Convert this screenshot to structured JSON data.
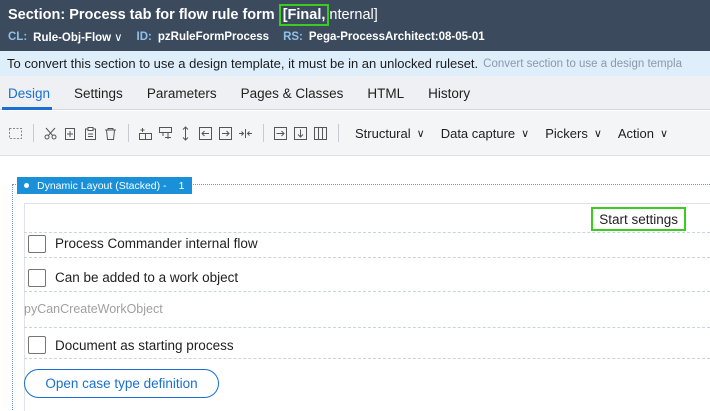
{
  "header": {
    "title": "Section: Process tab for flow rule form",
    "title_flag": "[Final,",
    "title_flag_rest": "nternal]",
    "meta": [
      {
        "label": "CL:",
        "value": "Rule-Obj-Flow",
        "chevron": "∨"
      },
      {
        "label": "ID:",
        "value": "pzRuleFormProcess",
        "chevron": ""
      },
      {
        "label": "RS:",
        "value": "Pega-ProcessArchitect:08-05-01",
        "chevron": ""
      }
    ]
  },
  "banner": {
    "message": "To convert this section to use a design template, it must be in an unlocked ruleset.",
    "link": "Convert section to use a design templa"
  },
  "tabs": [
    "Design",
    "Settings",
    "Parameters",
    "Pages & Classes",
    "HTML",
    "History"
  ],
  "active_tab": "Design",
  "toolbar": {
    "icons": [
      "select-icon",
      "cut-icon",
      "copy-icon",
      "paste-icon",
      "delete-icon",
      "add-row-icon",
      "insert-row-icon",
      "move-icon",
      "move-left-icon",
      "move-right-icon",
      "merge-icon",
      "indent-right-icon",
      "indent-down-icon",
      "columns-icon"
    ],
    "menus": [
      {
        "label": "Structural",
        "chevron": "∨"
      },
      {
        "label": "Data capture",
        "chevron": "∨"
      },
      {
        "label": "Pickers",
        "chevron": "∨"
      },
      {
        "label": "Action",
        "chevron": "∨"
      }
    ]
  },
  "canvas": {
    "layout_tag": "Dynamic Layout (Stacked) -",
    "layout_number": "1",
    "start_settings": "Start settings",
    "checkbox_internal_flow": "Process Commander internal flow",
    "checkbox_add_work_object": "Can be added to a work object",
    "property_name": "pyCanCreateWorkObject",
    "checkbox_starting_process": "Document as starting process",
    "case_type_button": "Open case type definition"
  },
  "colors": {
    "header_bg": "#3b4a5d",
    "highlight": "#3ccc1f",
    "accent": "#1a6fd0",
    "layout_tag_bg": "#1a90d8"
  }
}
